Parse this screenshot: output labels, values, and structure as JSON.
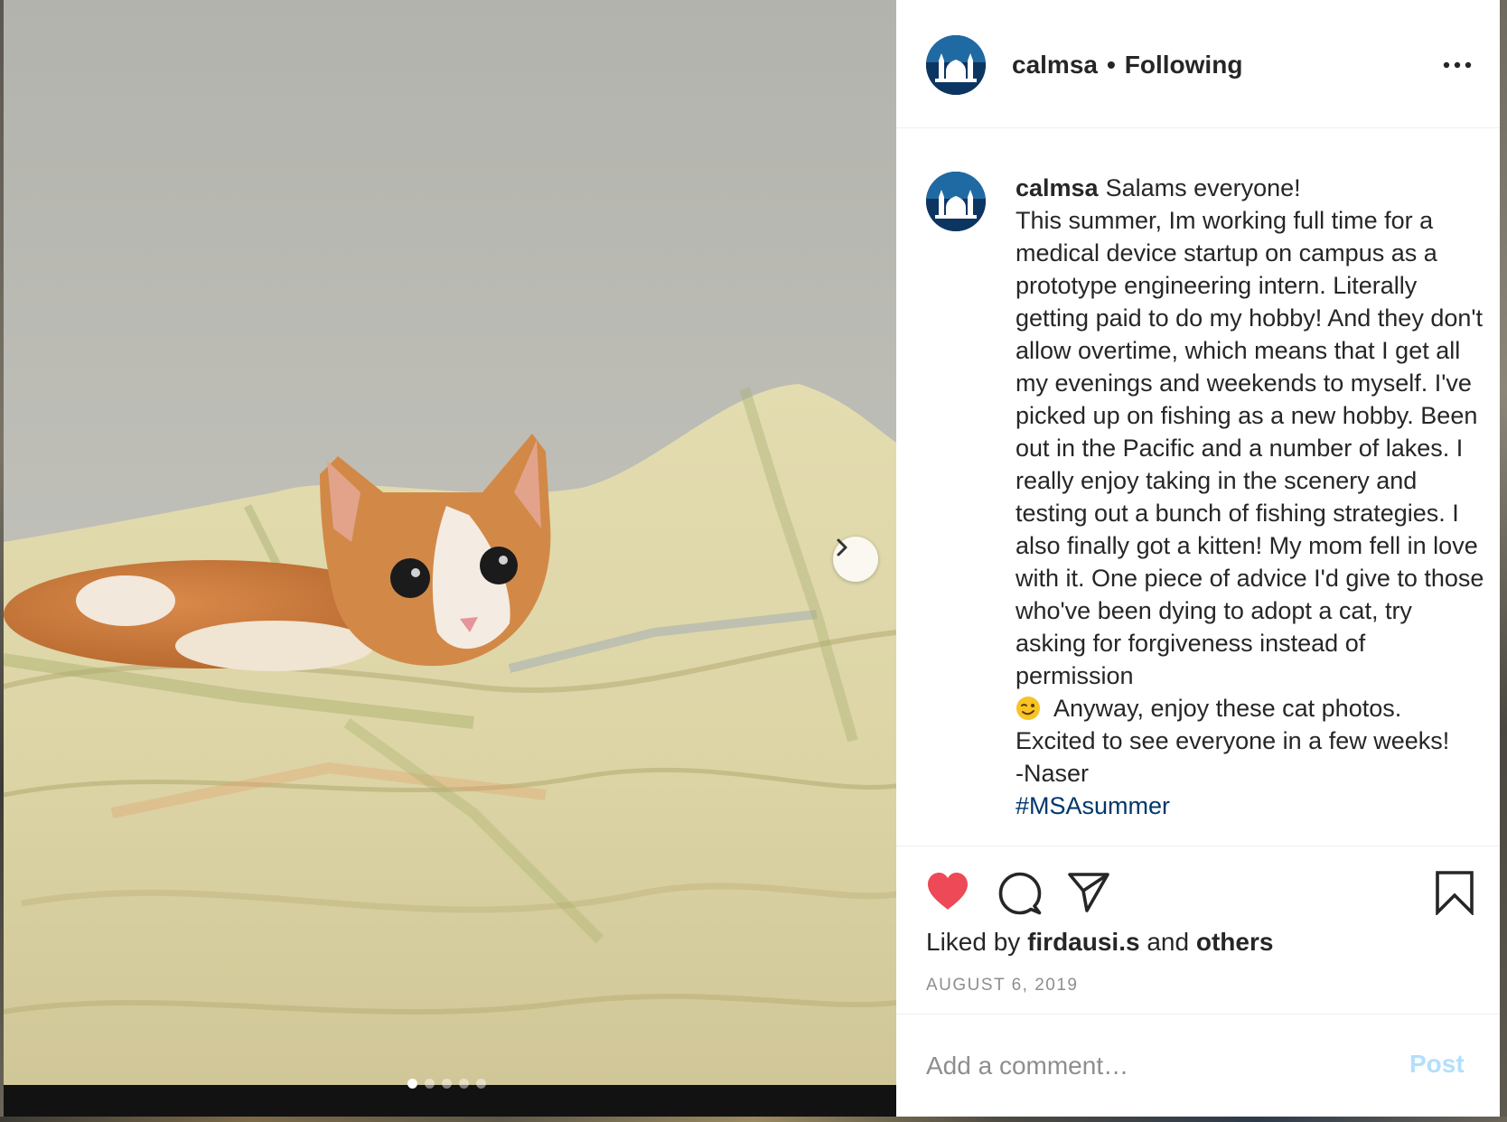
{
  "post": {
    "username": "calmsa",
    "separator": "•",
    "follow_status": "Following",
    "more_icon": "more-horizontal-icon"
  },
  "caption": {
    "username": "calmsa",
    "lines": [
      "Salams everyone!",
      "This summer, Im working full time for a medical device startup on campus as a prototype engineering intern. Literally getting paid to do my hobby! And they don't allow overtime, which means that I get all my evenings and weekends to myself. I've picked up on fishing as a new hobby. Been out in the Pacific and a number of lakes. I really enjoy taking in the scenery and testing out a bunch of fishing strategies. I also finally got a kitten! My mom fell in love with it. One piece of advice I'd give to those who've been dying to adopt a cat, try asking for forgiveness instead of permission"
    ],
    "emoji": "winking-face-emoji",
    "after_emoji": "Anyway, enjoy these cat photos. Excited to see everyone in a few weeks!",
    "signature": "-Naser",
    "hashtag": "#MSAsummer"
  },
  "actions": {
    "like_icon": "heart-filled-icon",
    "comment_icon": "comment-bubble-icon",
    "share_icon": "paper-plane-icon",
    "save_icon": "bookmark-icon",
    "like_color": "#ed4956"
  },
  "likes": {
    "prefix": "Liked by",
    "user": "firdausi.s",
    "conjunction": "and",
    "others": "others"
  },
  "date": "AUGUST 6, 2019",
  "comment": {
    "placeholder": "Add a comment…",
    "post_label": "Post"
  },
  "carousel": {
    "total_slides": 5,
    "active_slide": 1
  }
}
